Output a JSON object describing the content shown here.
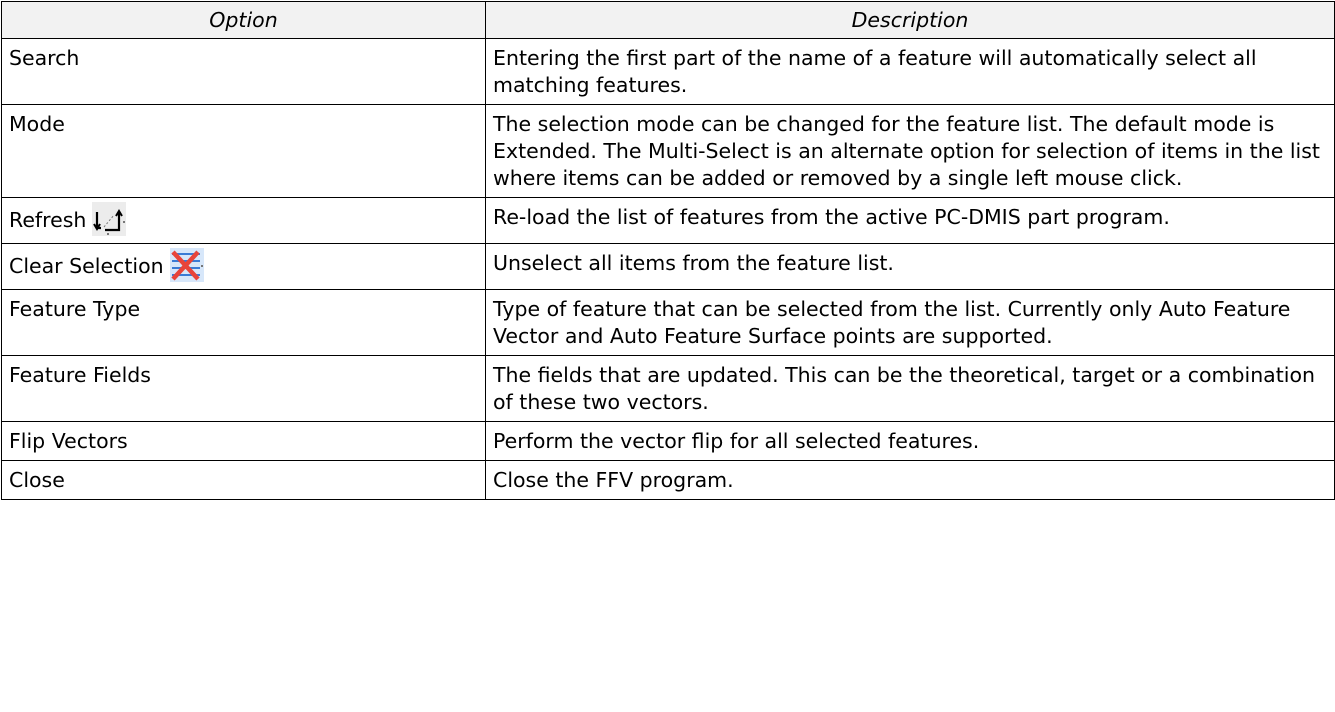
{
  "table": {
    "headers": {
      "option": "Option",
      "description": "Description"
    },
    "rows": [
      {
        "option": "Search",
        "description": "Entering the first part of the name of a feature will automatically select all matching features."
      },
      {
        "option": "Mode",
        "description": "The selection mode can be changed for the feature list.  The default mode is Extended.  The Multi-Select is an alternate option for selection of items in the list where items can be added or removed by a single left mouse click."
      },
      {
        "option": "Refresh",
        "icon": "refresh-icon",
        "description": "Re-load the list of features from the active PC-DMIS part program."
      },
      {
        "option": "Clear Selection",
        "icon": "clear-selection-icon",
        "description": "Unselect all items from the feature list."
      },
      {
        "option": "Feature Type",
        "description": "Type of feature that can be selected from the list.  Currently only Auto Feature Vector and Auto Feature Surface points are supported."
      },
      {
        "option": "Feature Fields",
        "description": "The fields that are updated.  This can be the theoretical, target or a combination of these two vectors."
      },
      {
        "option": "Flip Vectors",
        "description": "Perform the vector flip for all selected features."
      },
      {
        "option": "Close",
        "description": "Close the FFV program."
      }
    ]
  },
  "colors": {
    "border": "#000000",
    "header_background": "#f2f2f2",
    "clear_icon_x": "#e8443a",
    "clear_icon_lines": "#3a7bd5"
  }
}
